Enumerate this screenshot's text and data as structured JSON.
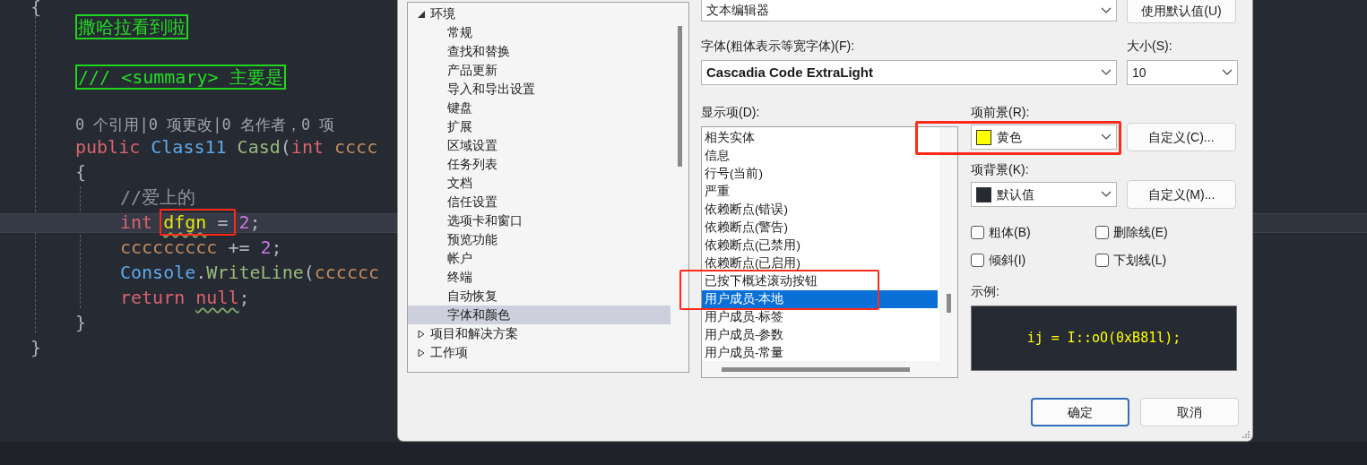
{
  "editor": {
    "lines": [
      {
        "kind": "code",
        "tokens": [
          {
            "kind": "punct",
            "text": "{"
          }
        ],
        "children": [
          {
            "kind": "tag",
            "tokens": [
              {
                "kind": "tag",
                "text": "撒哈拉看到啦"
              }
            ]
          },
          {
            "kind": "tag",
            "tokens": [
              {
                "kind": "tag",
                "text": "/// <summary> 主要是"
              }
            ]
          },
          {
            "kind": "lens",
            "tokens": [
              {
                "kind": "lens",
                "text": "0 个引用|0 项更改|0 名作者，0 项"
              }
            ]
          },
          {
            "kind": "code",
            "tokens": [
              {
                "kind": "keyword",
                "text": "public"
              },
              {
                "kind": "type",
                "text": " Class11"
              },
              {
                "kind": "method",
                "text": " Casd",
                "squiggle": false
              },
              {
                "kind": "punct",
                "text": "("
              },
              {
                "kind": "keyword",
                "text": "int"
              },
              {
                "kind": "param",
                "text": " cccc"
              }
            ]
          },
          {
            "kind": "code",
            "tokens": [
              {
                "kind": "punct",
                "text": "{"
              }
            ],
            "children": [
              {
                "kind": "code",
                "tokens": [
                  {
                    "kind": "comment",
                    "text": "//爱上的"
                  }
                ]
              },
              {
                "kind": "code",
                "current": true,
                "tokens": [
                  {
                    "kind": "keyword",
                    "text": "int "
                  },
                  {
                    "kind": "local",
                    "text": "dfgn",
                    "squiggle": true
                  },
                  {
                    "kind": "punct",
                    "text": " = "
                  },
                  {
                    "kind": "number",
                    "text": "2"
                  },
                  {
                    "kind": "punct",
                    "text": ";"
                  }
                ]
              },
              {
                "kind": "code",
                "tokens": [
                  {
                    "kind": "param",
                    "text": "ccccccccc"
                  },
                  {
                    "kind": "punct",
                    "text": " += "
                  },
                  {
                    "kind": "number",
                    "text": "2"
                  },
                  {
                    "kind": "punct",
                    "text": ";"
                  }
                ]
              },
              {
                "kind": "code",
                "tokens": [
                  {
                    "kind": "type",
                    "text": "Console"
                  },
                  {
                    "kind": "punct",
                    "text": "."
                  },
                  {
                    "kind": "method",
                    "text": "WriteLine"
                  },
                  {
                    "kind": "punct",
                    "text": "("
                  },
                  {
                    "kind": "param",
                    "text": "cccccc"
                  }
                ]
              },
              {
                "kind": "code",
                "tokens": [
                  {
                    "kind": "keyword",
                    "text": "return "
                  },
                  {
                    "kind": "keyword",
                    "text": "null",
                    "squiggle": true
                  },
                  {
                    "kind": "punct",
                    "text": ";"
                  }
                ]
              }
            ]
          },
          {
            "kind": "code",
            "tokens": [
              {
                "kind": "punct",
                "text": "}"
              }
            ]
          }
        ]
      },
      {
        "kind": "code",
        "tokens": [
          {
            "kind": "punct",
            "text": "}"
          }
        ]
      }
    ]
  },
  "dialog": {
    "tree": [
      {
        "label": "环境",
        "expanded": true,
        "selected": false,
        "children": [
          {
            "label": "常规",
            "selected": false
          },
          {
            "label": "查找和替换",
            "selected": false
          },
          {
            "label": "产品更新",
            "selected": false
          },
          {
            "label": "导入和导出设置",
            "selected": false
          },
          {
            "label": "键盘",
            "selected": false
          },
          {
            "label": "扩展",
            "selected": false
          },
          {
            "label": "区域设置",
            "selected": false
          },
          {
            "label": "任务列表",
            "selected": false
          },
          {
            "label": "文档",
            "selected": false
          },
          {
            "label": "信任设置",
            "selected": false
          },
          {
            "label": "选项卡和窗口",
            "selected": false
          },
          {
            "label": "预览功能",
            "selected": false
          },
          {
            "label": "帐户",
            "selected": false
          },
          {
            "label": "终端",
            "selected": false
          },
          {
            "label": "自动恢复",
            "selected": false
          },
          {
            "label": "字体和颜色",
            "selected": true
          }
        ]
      },
      {
        "label": "项目和解决方案",
        "expanded": false,
        "selected": false
      },
      {
        "label": "工作项",
        "expanded": false,
        "selected": false
      }
    ],
    "show_settings_for": {
      "value": "文本编辑器"
    },
    "use_defaults_button": "使用默认值(U)",
    "font": {
      "label": "字体(粗体表示等宽字体)(F):",
      "value": "Cascadia Code ExtraLight"
    },
    "size": {
      "label": "大小(S):",
      "value": "10"
    },
    "display_items": {
      "label": "显示项(D):",
      "items": [
        {
          "label": "相关实体",
          "selected": false
        },
        {
          "label": "信息",
          "selected": false
        },
        {
          "label": "行号(当前)",
          "selected": false
        },
        {
          "label": "严重",
          "selected": false
        },
        {
          "label": "依赖断点(错误)",
          "selected": false
        },
        {
          "label": "依赖断点(警告)",
          "selected": false
        },
        {
          "label": "依赖断点(已禁用)",
          "selected": false
        },
        {
          "label": "依赖断点(已启用)",
          "selected": false
        },
        {
          "label": "已按下概述滚动按钮",
          "selected": false
        },
        {
          "label": "用户成员-本地",
          "selected": true
        },
        {
          "label": "用户成员-标签",
          "selected": false
        },
        {
          "label": "用户成员-参数",
          "selected": false
        },
        {
          "label": "用户成员-常量",
          "selected": false
        }
      ]
    },
    "foreground": {
      "label": "项前景(R):",
      "value": "黄色",
      "color": "#ffff00",
      "button": "自定义(C)..."
    },
    "background": {
      "label": "项背景(K):",
      "value": "默认值",
      "color": "#262a33",
      "button": "自定义(M)..."
    },
    "checkboxes": [
      {
        "label": "粗体(B)",
        "checked": false
      },
      {
        "label": "删除线(E)",
        "checked": false
      },
      {
        "label": "倾斜(I)",
        "checked": false
      },
      {
        "label": "下划线(L)",
        "checked": false
      }
    ],
    "sample": {
      "label": "示例:",
      "text": "ij = I::oO(0xB81l);"
    },
    "buttons": [
      {
        "label": "确定",
        "default": true
      },
      {
        "label": "取消",
        "default": false
      }
    ]
  }
}
